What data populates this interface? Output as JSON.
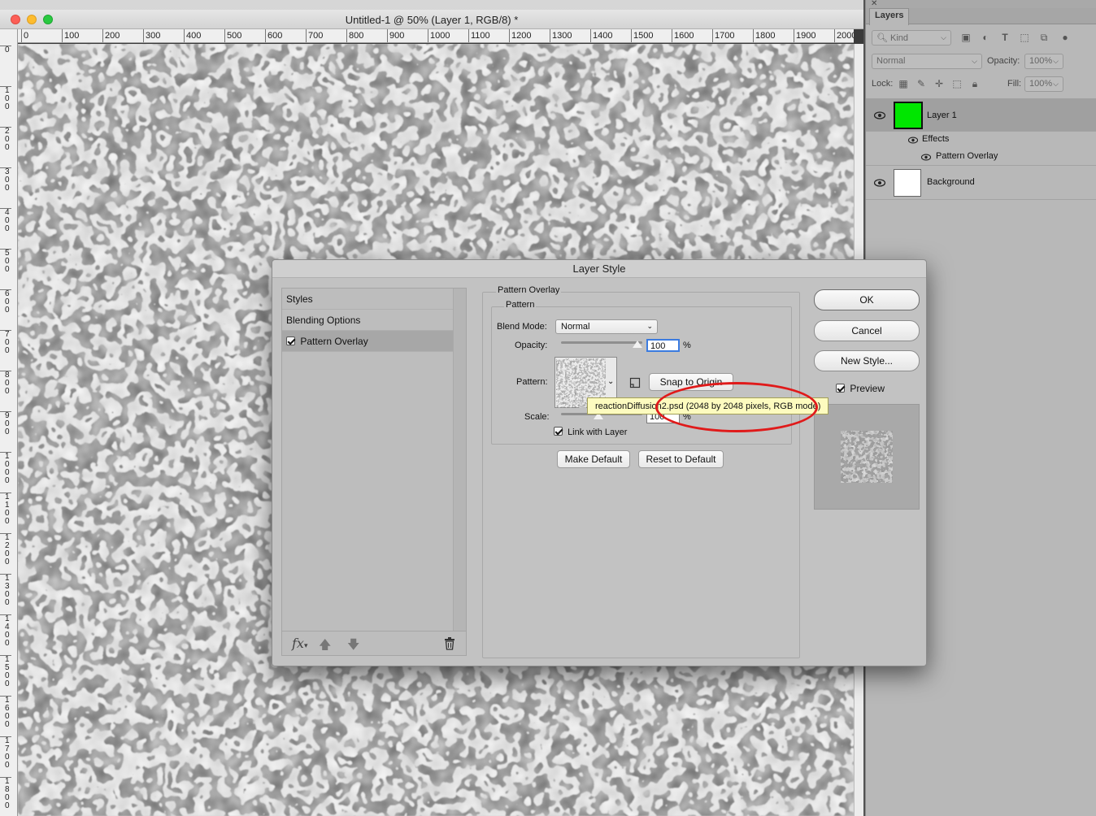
{
  "document": {
    "title": "Untitled-1 @ 50% (Layer 1, RGB/8) *",
    "ruler_h": [
      "0",
      "100",
      "200",
      "300",
      "400",
      "500",
      "600",
      "700",
      "800",
      "900",
      "1000",
      "1100",
      "1200",
      "1300",
      "1400",
      "1500",
      "1600",
      "1700",
      "1800",
      "1900",
      "2000"
    ],
    "ruler_v": [
      "0",
      "100",
      "200",
      "300",
      "400",
      "500",
      "600",
      "700",
      "800",
      "900",
      "1000",
      "1100",
      "1200",
      "1300",
      "1400",
      "1500",
      "1600",
      "1700",
      "1800"
    ]
  },
  "layers_panel": {
    "tab": "Layers",
    "kind_filter": "Kind",
    "blend_mode": "Normal",
    "opacity_label": "Opacity:",
    "opacity_value": "100%",
    "lock_label": "Lock:",
    "fill_label": "Fill:",
    "fill_value": "100%",
    "layers": [
      {
        "name": "Layer 1",
        "thumb_color": "#00e600",
        "selected": true
      },
      {
        "name": "Effects"
      },
      {
        "name": "Pattern Overlay"
      },
      {
        "name": "Background",
        "thumb_color": "#ffffff"
      }
    ]
  },
  "dialog": {
    "title": "Layer Style",
    "styles": [
      "Styles",
      "Blending Options",
      "Pattern Overlay"
    ],
    "section_title": "Pattern Overlay",
    "subsection_title": "Pattern",
    "blend_mode_label": "Blend Mode:",
    "blend_mode_value": "Normal",
    "opacity_label": "Opacity:",
    "opacity_value": "100",
    "opacity_percent": 100,
    "pct": "%",
    "pattern_label": "Pattern:",
    "snap_label": "Snap to Origin",
    "scale_label": "Scale:",
    "scale_value": "100",
    "link_label": "Link with Layer",
    "make_default": "Make Default",
    "reset_default": "Reset to Default",
    "ok": "OK",
    "cancel": "Cancel",
    "new_style": "New Style...",
    "preview_label": "Preview",
    "tooltip": "reactionDiffusion2.psd (2048 by 2048 pixels, RGB mode)"
  },
  "colors": {
    "accent_green": "#00e600",
    "annotation_red": "#e01a1a",
    "tooltip_bg": "#fdfbbf"
  }
}
